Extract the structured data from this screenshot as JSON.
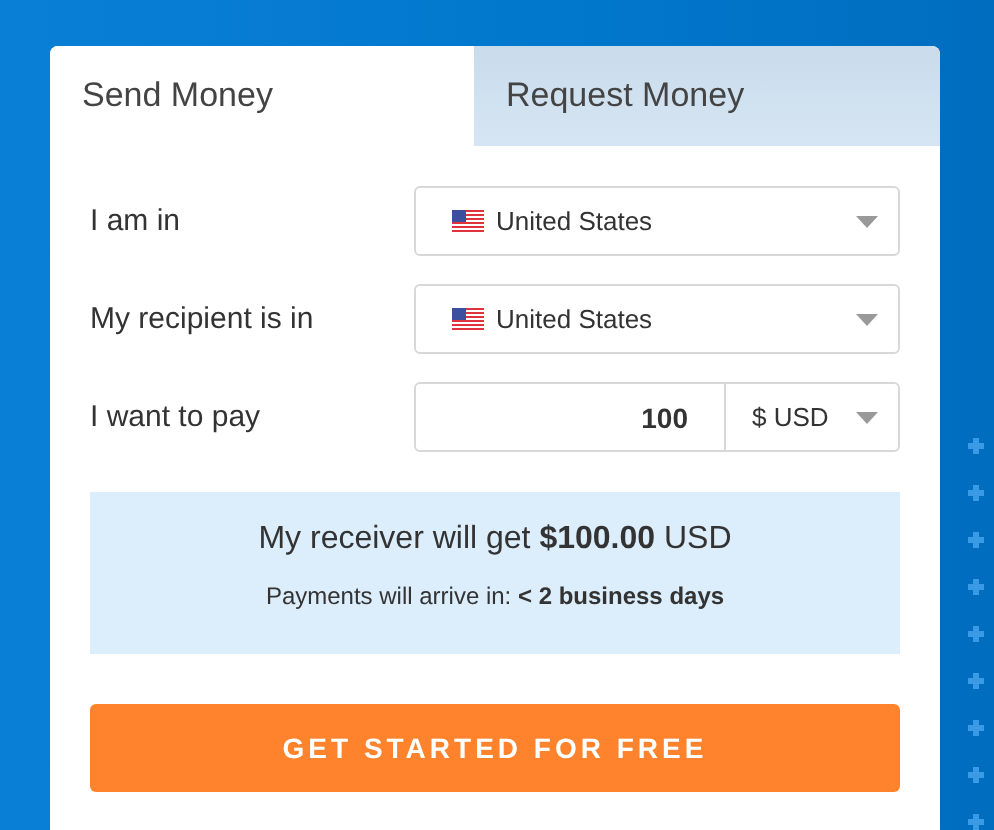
{
  "tabs": [
    {
      "label": "Send Money",
      "selected": true
    },
    {
      "label": "Request Money",
      "selected": false
    }
  ],
  "fields": [
    {
      "kind": "country",
      "label": "I am in",
      "value": "United States"
    },
    {
      "kind": "country",
      "label": "My recipient is in",
      "value": "United States"
    },
    {
      "kind": "amount",
      "label": "I want to pay",
      "value": "100",
      "currency": "$ USD"
    }
  ],
  "summary": {
    "receive": "My receiver will get **$100.00** USD",
    "arrival": "Payments will arrive in: **< 2 business days**"
  },
  "button": "GET STARTED FOR FREE"
}
